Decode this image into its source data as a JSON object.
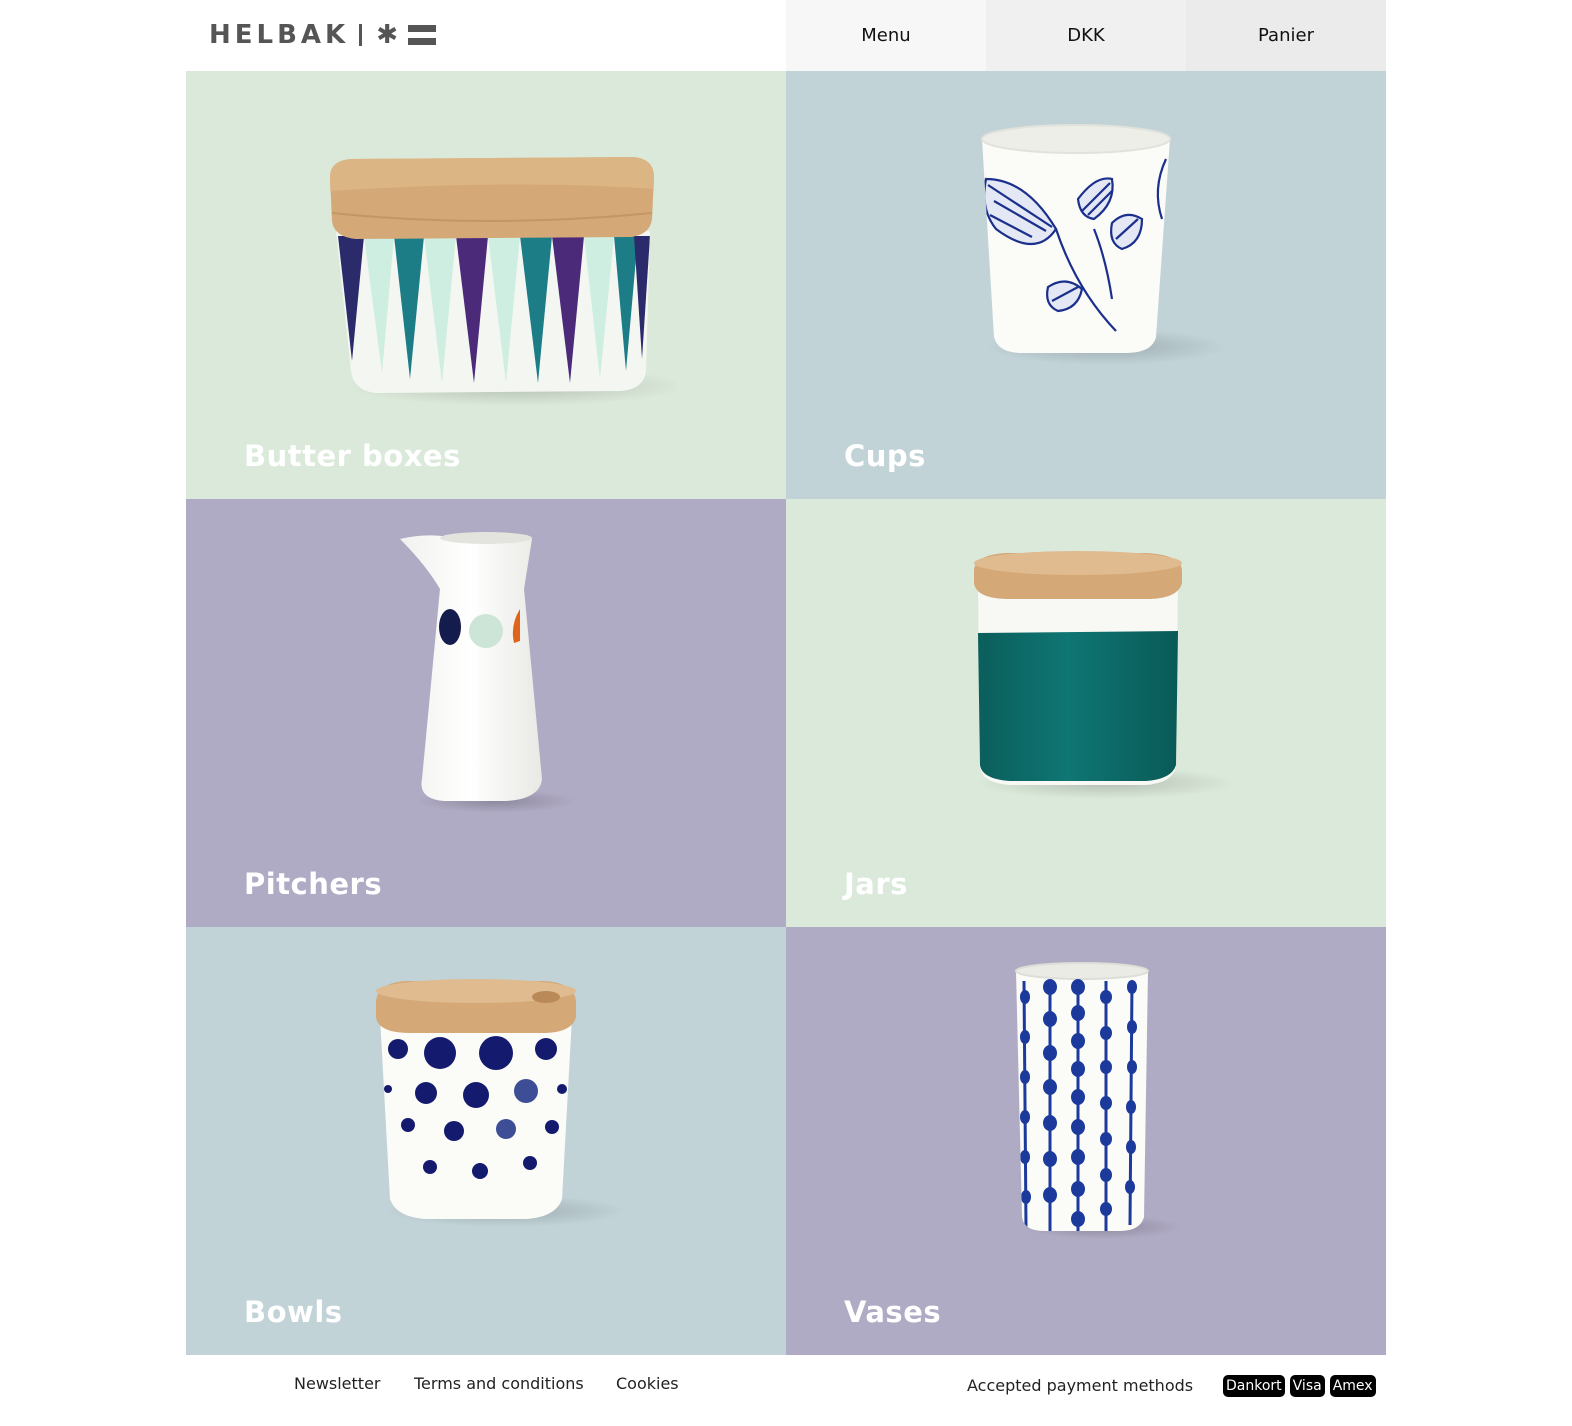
{
  "header": {
    "logo_text": "HELBAK",
    "logo_star": "✱",
    "nav": {
      "menu_label": "Menu",
      "currency_label": "DKK",
      "cart_label": "Panier"
    }
  },
  "categories": [
    {
      "label": "Butter boxes",
      "bg": "#dbe9da"
    },
    {
      "label": "Cups",
      "bg": "#c1d3d7"
    },
    {
      "label": "Pitchers",
      "bg": "#b0abc4"
    },
    {
      "label": "Jars",
      "bg": "#dbe9da"
    },
    {
      "label": "Bowls",
      "bg": "#c1d3d7"
    },
    {
      "label": "Vases",
      "bg": "#b0abc4"
    }
  ],
  "footer": {
    "links": [
      "Newsletter",
      "Terms and conditions",
      "Cookies"
    ],
    "payment_label": "Accepted payment methods",
    "payment_methods": [
      "Dankort",
      "Visa",
      "Amex"
    ]
  },
  "colors": {
    "navy": "#1b2f8c",
    "teal": "#0e6e6b",
    "purple": "#4c2a7a",
    "mint": "#cdeee0",
    "wood": "#d4a877",
    "orange": "#e0631c"
  }
}
